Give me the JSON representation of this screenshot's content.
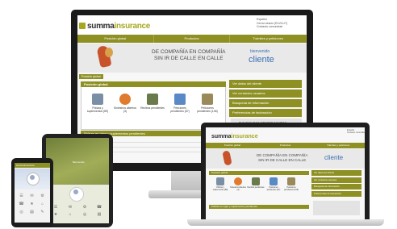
{
  "brand": {
    "name_main": "summa",
    "name_accent": "insurance"
  },
  "header_right": {
    "lang": "Español",
    "logout": "Cerrar sesión (ELVILUT)",
    "contact": "Contacto comunidad"
  },
  "nav": [
    "Posición global",
    "Productos",
    "Trámites y peticiones"
  ],
  "banner": {
    "line1": "DE COMPAÑÍA EN COMPAÑÍA",
    "line2": "SIN IR DE CALLE EN CALLE",
    "welcome": "bienvenido",
    "client": "cliente"
  },
  "breadcrumb": "Posición global",
  "panel_title": "Posición global",
  "tiles": [
    {
      "label": "Pólizas y suplementos (89)",
      "color": "#7a8fa6"
    },
    {
      "label": "Siniestros abiertos (3)",
      "color": "#e07a2d"
    },
    {
      "label": "Recibos pendientes",
      "color": "#6a7a4a"
    },
    {
      "label": "Peticiones pendientes (67)",
      "color": "#5a8ac6"
    },
    {
      "label": "Peticiones pendientes (106)",
      "color": "#9a8a5a"
    }
  ],
  "side_menu": [
    "Ver datos del cliente",
    "Ver contactos usuarios",
    "Búsqueda de información",
    "Preferencias de facturación"
  ],
  "side_promo": "TUS SEGUROS SIEMPRE CONTIGO",
  "table_title": "Pólizas en vigor y suplementos pendientes",
  "tablet": {
    "title": "Bienvenido",
    "icons": [
      "☰",
      "✉",
      "⚙",
      "☎",
      "★",
      "⌂",
      "◎",
      "▤"
    ]
  },
  "phone": {
    "icons": [
      "☰",
      "✉",
      "⚙",
      "☎",
      "★",
      "⌂",
      "◎",
      "▤",
      "✎"
    ]
  }
}
